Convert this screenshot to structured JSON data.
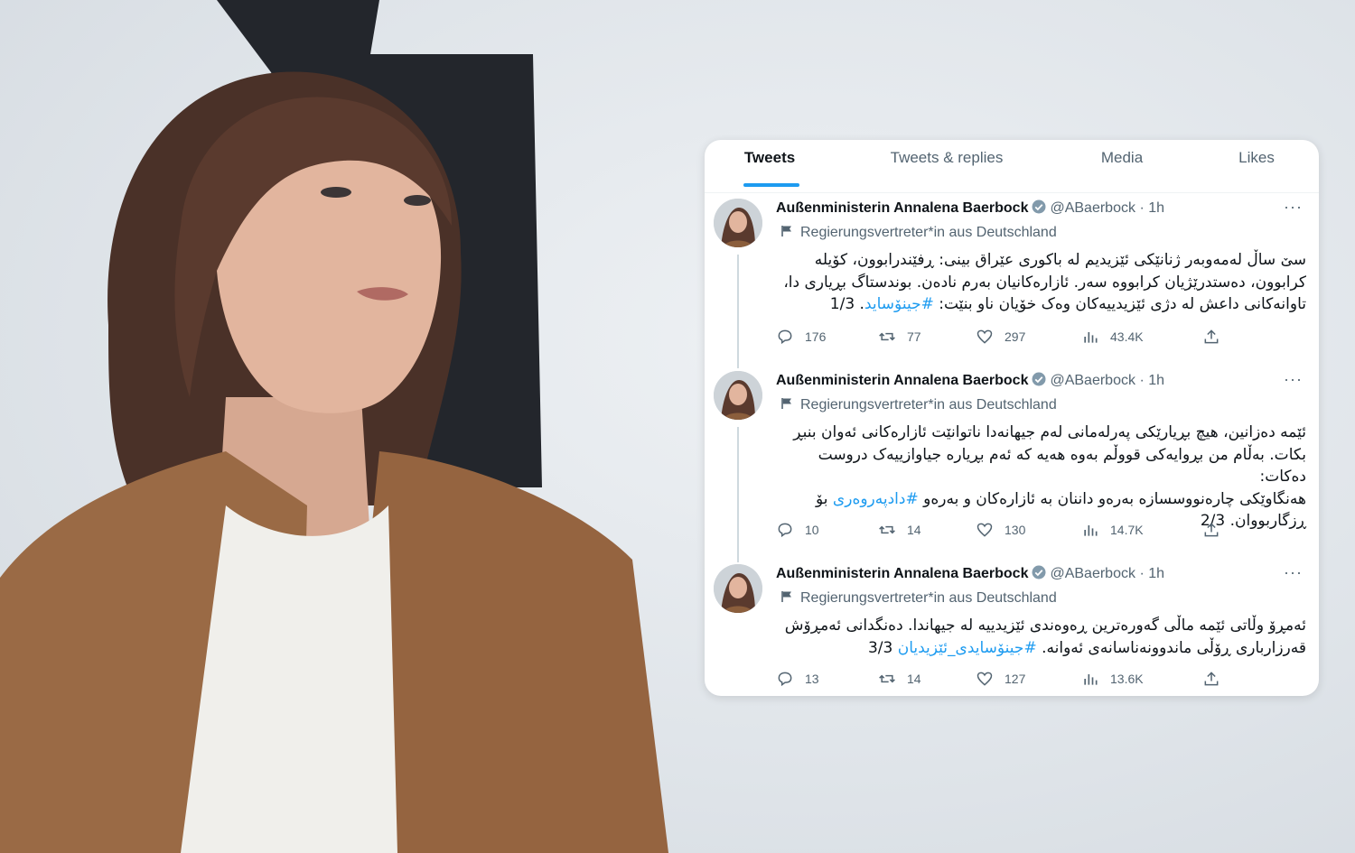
{
  "tabs": [
    {
      "label": "Tweets",
      "active": true
    },
    {
      "label": "Tweets & replies",
      "active": false
    },
    {
      "label": "Media",
      "active": false
    },
    {
      "label": "Likes",
      "active": false
    }
  ],
  "colors": {
    "accent": "#1d9bf0",
    "text": "#0f1419",
    "muted": "#536471",
    "jacket": "#9a6a45"
  },
  "tweets": [
    {
      "name": "Außenministerin Annalena Baerbock",
      "handle": "@ABaerbock",
      "time": "· 1h",
      "more": "···",
      "affiliation": "Regierungsvertreter*in aus Deutschland",
      "lines": [
        "سێ ساڵ لەمەوبەر ژنانێکی ئێزیدیم لە باکوری عێراق بینی: ڕفێندرابوون، کۆیلە",
        "کرابوون، دەستدرێژیان کرابووە سەر. ئازارەکانیان بەرم نادەن. بوندستاگ بڕیاری دا،",
        "تاوانەکانی داعش لە دژی ئێزیدییەکان وەک خۆیان ناو بنێت: ",
        "#جینۆساید",
        ". 1/3"
      ],
      "replies": "176",
      "retweets": "77",
      "likes": "297",
      "views": "43.4K"
    },
    {
      "name": "Außenministerin Annalena Baerbock",
      "handle": "@ABaerbock",
      "time": "· 1h",
      "more": "···",
      "affiliation": "Regierungsvertreter*in aus Deutschland",
      "lines": [
        "ئێمە دەزانین، هیچ بڕیارێکی پەرلەمانی لەم جیهانەدا ناتوانێت ئازارەکانی ئەوان بنبڕ",
        "بکات. بەڵام من بڕوایەکی قووڵم بەوە هەیە کە ئەم بڕیارە جیاوازییەک دروست دەکات:",
        "هەنگاوێکی چارەنووسسازە بەرەو داننان بە ئازارەکان و بەرەو ",
        "#دادپەروەری",
        " بۆ",
        "ڕزگاربووان. 2/3"
      ],
      "replies": "10",
      "retweets": "14",
      "likes": "130",
      "views": "14.7K"
    },
    {
      "name": "Außenministerin Annalena Baerbock",
      "handle": "@ABaerbock",
      "time": "· 1h",
      "more": "···",
      "affiliation": "Regierungsvertreter*in aus Deutschland",
      "lines": [
        "ئەمڕۆ وڵاتی ئێمە ماڵی گەورەترین ڕەوەندی ئێزیدییە لە جیهاندا. دەنگدانی ئەمڕۆش",
        "قەرزارباری ڕۆڵی ماندوونەناسانەی ئەوانە. ",
        "#جینۆسایدی_ئێزیدیان",
        " 3/3"
      ],
      "replies": "13",
      "retweets": "14",
      "likes": "127",
      "views": "13.6K"
    }
  ]
}
